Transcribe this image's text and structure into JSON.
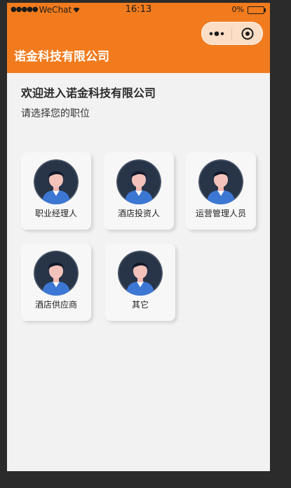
{
  "status_bar": {
    "signal": "●●●●●",
    "carrier": "WeChat",
    "time": "16:13",
    "battery": "0%"
  },
  "nav": {
    "title": "诺金科技有限公司",
    "more_icon": "more-dots-icon",
    "close_icon": "target-close-icon"
  },
  "page": {
    "welcome": "欢迎进入诺金科技有限公司",
    "subtitle": "请选择您的职位"
  },
  "roles": [
    {
      "label": "职业经理人"
    },
    {
      "label": "酒店投资人"
    },
    {
      "label": "运营管理人员"
    },
    {
      "label": "酒店供应商"
    },
    {
      "label": "其它"
    }
  ],
  "colors": {
    "brand_orange": "#f27b1d",
    "page_bg": "#f2f2f2",
    "avatar_bg": "#283447",
    "avatar_shirt": "#3d77d4"
  }
}
